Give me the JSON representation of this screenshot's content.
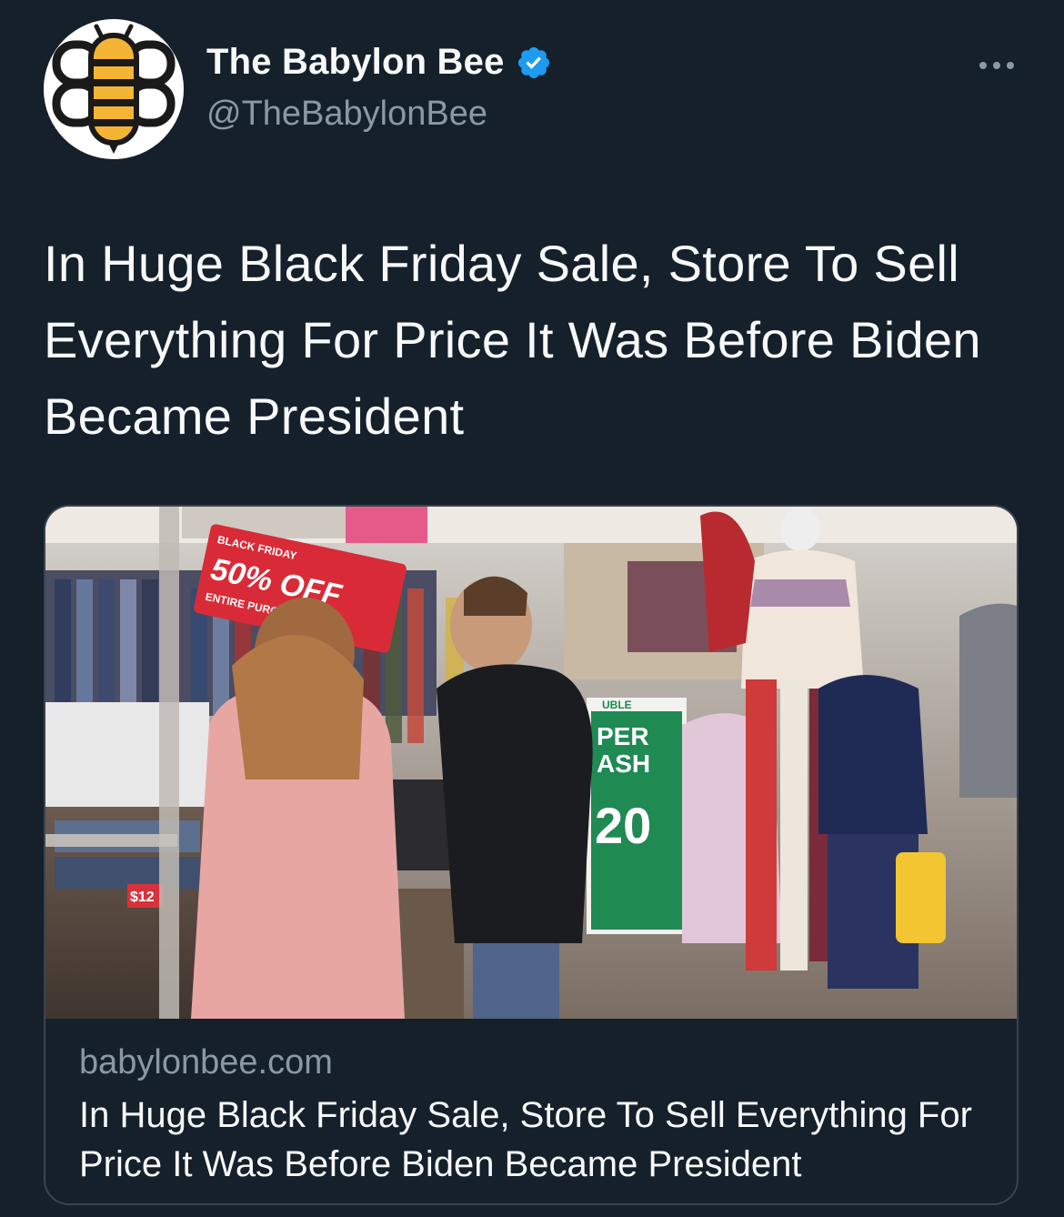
{
  "author": {
    "display_name": "The Babylon Bee",
    "handle": "@TheBabylonBee",
    "avatar_icon": "bee-logo-icon",
    "verified": true,
    "verified_icon": "verified-badge-icon"
  },
  "more_icon": "more-options-icon",
  "tweet_text": "In Huge Black Friday Sale, Store To Sell Everything For Price It Was Before Biden Became President",
  "card": {
    "domain": "babylonbee.com",
    "title": "In Huge Black Friday Sale, Store To Sell Everything For Price It Was Before Biden Became President",
    "image": {
      "description_icon": "store-photo-image",
      "sign_discount": "50% OFF",
      "sign_small_top": "BLACK FRIDAY",
      "sign_small_bottom": "ENTIRE PURCHASE",
      "green_sign_top": "UBLE",
      "green_sign_line1": "PER",
      "green_sign_line2": "ASH",
      "green_sign_value": "20",
      "price_tag": "$12"
    }
  },
  "colors": {
    "background": "#15202b",
    "border": "#38444d",
    "text_primary": "#f7f9f9",
    "text_secondary": "#8b98a5",
    "verified_blue": "#1d9bf0",
    "bee_yellow": "#f5b534"
  }
}
